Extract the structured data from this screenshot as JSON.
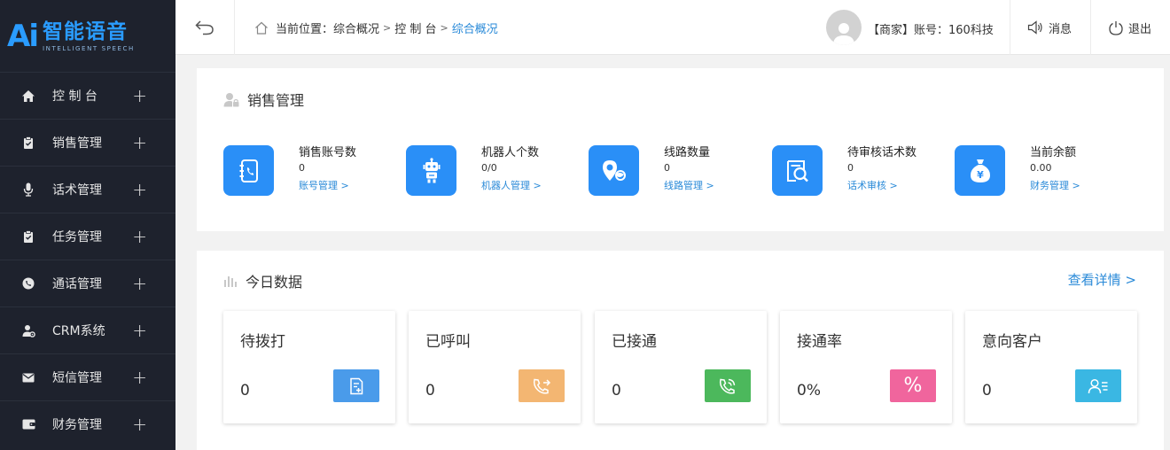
{
  "logo": {
    "mark": "Ai",
    "cn": "智能语音",
    "en": "INTELLIGENT SPEECH"
  },
  "sidebar": {
    "items": [
      {
        "label": "控 制 台",
        "icon": "home-icon"
      },
      {
        "label": "销售管理",
        "icon": "clipboard-icon"
      },
      {
        "label": "话术管理",
        "icon": "microphone-icon"
      },
      {
        "label": "任务管理",
        "icon": "task-icon"
      },
      {
        "label": "通话管理",
        "icon": "phone-circle-icon"
      },
      {
        "label": "CRM系统",
        "icon": "user-gear-icon"
      },
      {
        "label": "短信管理",
        "icon": "envelope-icon"
      },
      {
        "label": "财务管理",
        "icon": "wallet-icon"
      }
    ],
    "expand_symbol": "+"
  },
  "topbar": {
    "breadcrumb": {
      "prefix": "当前位置：",
      "items": [
        "综合概况",
        "控 制 台"
      ],
      "current": "综合概况",
      "separator": ">"
    },
    "account": "【商家】账号：160科技",
    "messages_label": "消息",
    "logout_label": "退出"
  },
  "sales": {
    "title": "销售管理",
    "stats": [
      {
        "label": "销售账号数",
        "value": "0",
        "link": "账号管理 >",
        "icon": "contact-book-icon"
      },
      {
        "label": "机器人个数",
        "value": "0/0",
        "link": "机器人管理 >",
        "icon": "robot-icon"
      },
      {
        "label": "线路数量",
        "value": "0",
        "link": "线路管理 >",
        "icon": "location-pin-icon"
      },
      {
        "label": "待审核话术数",
        "value": "0",
        "link": "话术审核 >",
        "icon": "document-search-icon"
      },
      {
        "label": "当前余额",
        "value": "0.00",
        "link": "财务管理 >",
        "icon": "money-bag-icon"
      }
    ]
  },
  "today": {
    "title": "今日数据",
    "detail_link": "查看详情 >",
    "cards": [
      {
        "label": "待拨打",
        "value": "0",
        "color": "#4a9bea",
        "icon": "document-add-icon"
      },
      {
        "label": "已呼叫",
        "value": "0",
        "color": "#f3b672",
        "icon": "phone-outgoing-icon"
      },
      {
        "label": "已接通",
        "value": "0",
        "color": "#4cb85c",
        "icon": "phone-connected-icon"
      },
      {
        "label": "接通率",
        "value": "0%",
        "color": "#f0659d",
        "icon": "percent-icon",
        "badge_text": "%"
      },
      {
        "label": "意向客户",
        "value": "0",
        "color": "#3ab7e3",
        "icon": "contact-card-icon"
      }
    ]
  },
  "colors": {
    "accent": "#2a8ff7",
    "link": "#2a8ad8",
    "sidebar_bg": "#1e222d"
  }
}
